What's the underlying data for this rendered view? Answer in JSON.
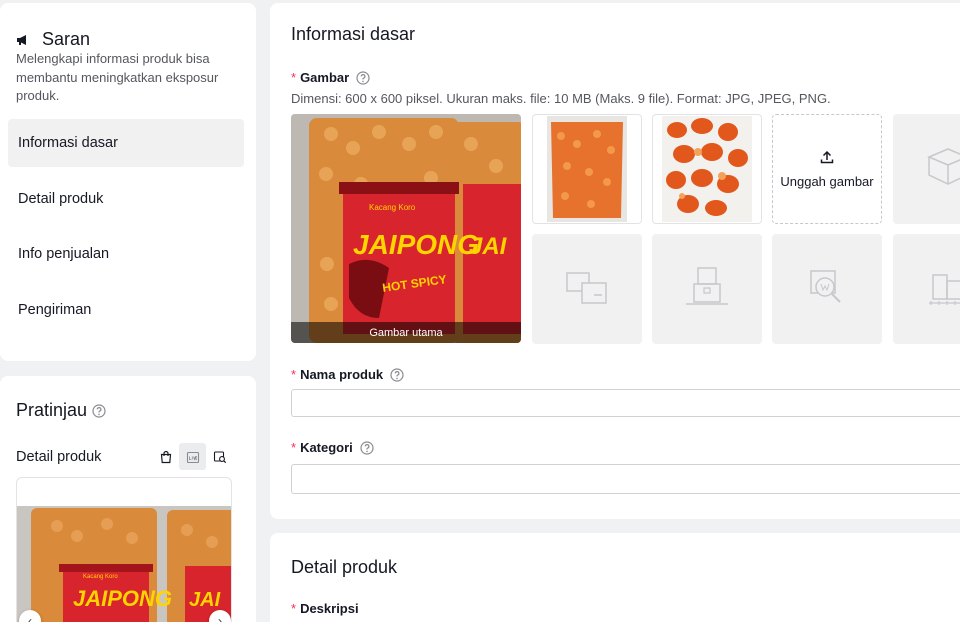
{
  "suggestion": {
    "title": "Saran",
    "description": "Melengkapi informasi produk bisa membantu meningkatkan eksposur produk."
  },
  "nav": {
    "items": [
      {
        "label": "Informasi dasar",
        "active": true
      },
      {
        "label": "Detail produk",
        "active": false
      },
      {
        "label": "Info penjualan",
        "active": false
      },
      {
        "label": "Pengiriman",
        "active": false
      }
    ]
  },
  "preview": {
    "title": "Pratinjau",
    "subtitle": "Detail produk",
    "tools": [
      "shopping-bag-icon",
      "live-icon",
      "search-card-icon"
    ]
  },
  "basic_info": {
    "title": "Informasi dasar",
    "image_field": {
      "label": "Gambar",
      "requirements": "Dimensi: 600 x 600 piksel. Ukuran maks. file: 10 MB (Maks. 9 file). Format: JPG, JPEG, PNG.",
      "main_caption": "Gambar utama",
      "upload_label": "Unggah gambar",
      "main_brand_text": "JAIPONG",
      "main_product_text": "Kacang Koro",
      "main_flavor_text": "HOT SPICY"
    },
    "name_field": {
      "label": "Nama produk",
      "value": ""
    },
    "category_field": {
      "label": "Kategori",
      "value": ""
    }
  },
  "detail": {
    "title": "Detail produk",
    "description_label": "Deskripsi"
  },
  "colors": {
    "required": "#fe2c55",
    "background": "#f0f1f2",
    "active_nav": "#f1f1f2",
    "placeholder_slot": "#f1f1f2"
  }
}
